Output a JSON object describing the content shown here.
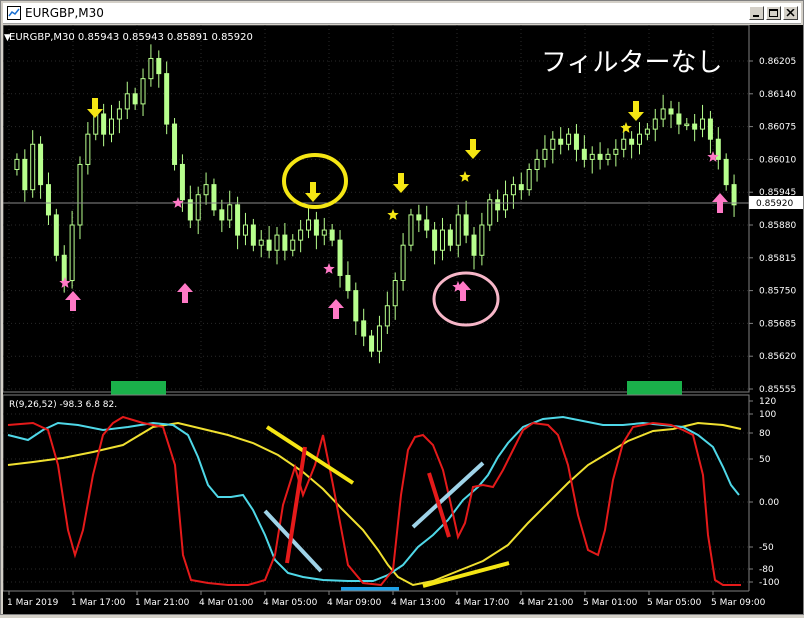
{
  "window": {
    "title": "EURGBP,M30"
  },
  "main_chart": {
    "header": "EURGBP,M30  0.85943 0.85943 0.85891 0.85920",
    "annotation": "フィルターなし",
    "price_label": "0.85920",
    "y_ticks": [
      "0.86205",
      "0.86140",
      "0.86075",
      "0.86010",
      "0.85945",
      "0.85880",
      "0.85815",
      "0.85750",
      "0.85685",
      "0.85620",
      "0.85555"
    ]
  },
  "indicator": {
    "header": "R(9,26,52) -98.3 6.8 82.",
    "y_ticks": [
      "120",
      "100",
      "80",
      "50",
      "0.00",
      "-50",
      "-80",
      "-100"
    ]
  },
  "x_ticks": [
    "1 Mar 2019",
    "1 Mar 17:00",
    "1 Mar 21:00",
    "4 Mar 01:00",
    "4 Mar 05:00",
    "4 Mar 09:00",
    "4 Mar 13:00",
    "4 Mar 17:00",
    "4 Mar 21:00",
    "5 Mar 01:00",
    "5 Mar 05:00",
    "5 Mar 09:00"
  ],
  "colors": {
    "candle": "#b8ff8e",
    "red_line": "#e51a1a",
    "cyan_line": "#4fd8e8",
    "yellow_line": "#f0e030",
    "pink_arrow": "#ff79c6",
    "yellow_arrow": "#f5e614",
    "green_box": "#1ab04a",
    "blue_box": "#1ea0e6"
  },
  "chart_data": {
    "type": "candlestick",
    "symbol": "EURGBP",
    "timeframe": "M30",
    "y_range": [
      0.85555,
      0.86205
    ],
    "closes": [
      0.8601,
      0.8595,
      0.8604,
      0.8596,
      0.859,
      0.8582,
      0.8577,
      0.8588,
      0.86,
      0.8606,
      0.861,
      0.8606,
      0.8609,
      0.8611,
      0.8614,
      0.8612,
      0.8617,
      0.8621,
      0.8618,
      0.8608,
      0.86,
      0.8593,
      0.8589,
      0.8594,
      0.8596,
      0.8591,
      0.8589,
      0.8592,
      0.8586,
      0.8588,
      0.8584,
      0.8585,
      0.8583,
      0.8586,
      0.8583,
      0.8585,
      0.8587,
      0.8589,
      0.8586,
      0.8587,
      0.8585,
      0.8578,
      0.8575,
      0.8569,
      0.8566,
      0.8563,
      0.8568,
      0.8572,
      0.8577,
      0.8584,
      0.859,
      0.8589,
      0.8587,
      0.8583,
      0.8587,
      0.8584,
      0.859,
      0.8586,
      0.8582,
      0.8588,
      0.8593,
      0.8591,
      0.8594,
      0.8596,
      0.8595,
      0.8599,
      0.8601,
      0.8603,
      0.8605,
      0.8604,
      0.8606,
      0.8603,
      0.8601,
      0.8602,
      0.8601,
      0.8602,
      0.8603,
      0.8605,
      0.8604,
      0.8606,
      0.8607,
      0.8609,
      0.8611,
      0.861,
      0.8608,
      0.8608,
      0.8607,
      0.8609,
      0.8605,
      0.8601,
      0.8596,
      0.8592
    ]
  }
}
